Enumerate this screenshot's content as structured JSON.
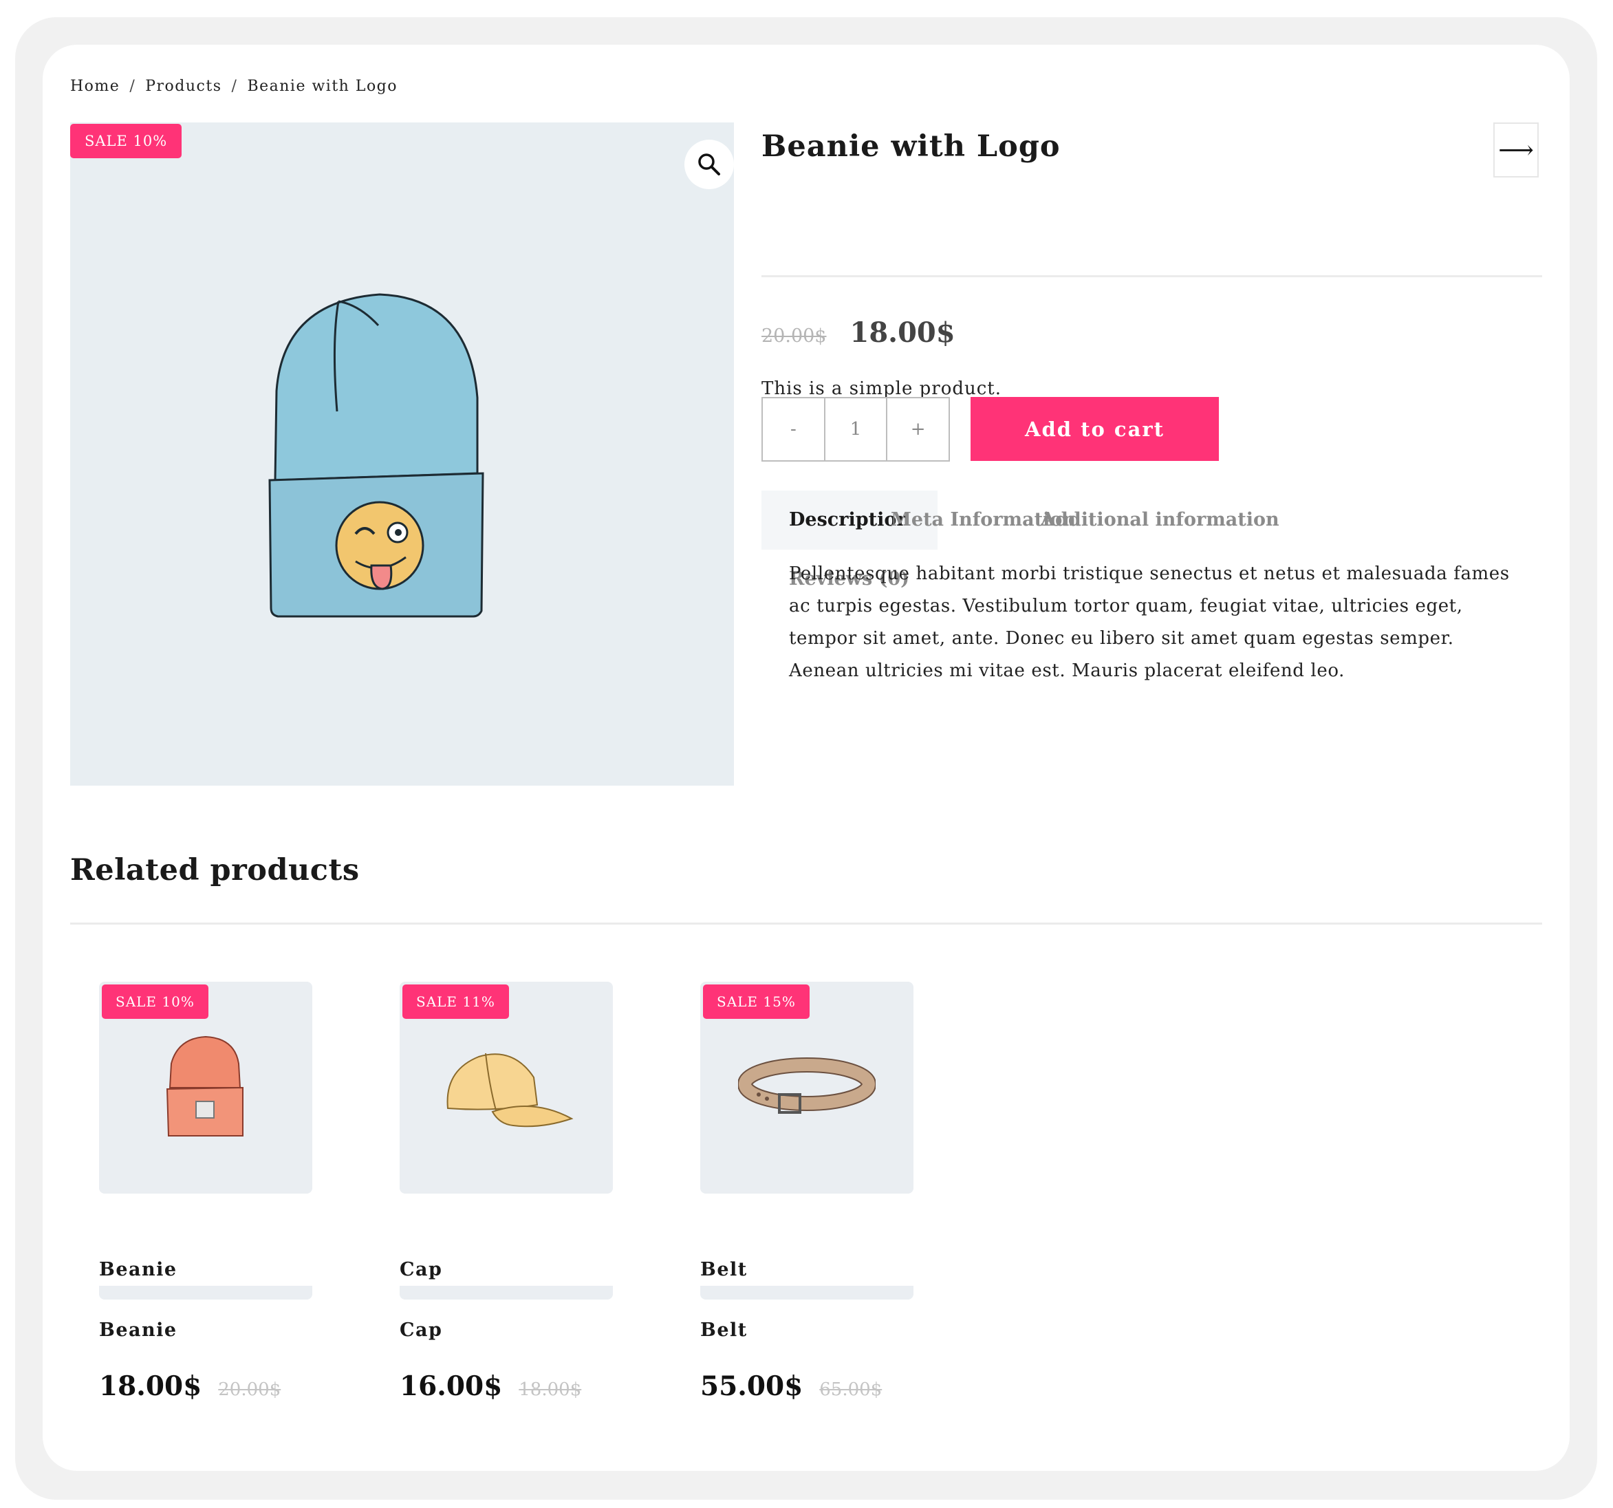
{
  "breadcrumb": {
    "home": "Home",
    "products": "Products",
    "current": "Beanie with Logo",
    "separator": "/"
  },
  "product": {
    "sale_badge": "SALE 10%",
    "title": "Beanie with Logo",
    "old_price": "20.00$",
    "price": "18.00$",
    "short_description": "This is a simple product.",
    "quantity": {
      "minus": "-",
      "value": "1",
      "plus": "+"
    },
    "add_to_cart": "Add to cart",
    "next_icon": "arrow-right-icon",
    "zoom_icon": "search-icon"
  },
  "tabs": [
    {
      "label": "Description",
      "active": true
    },
    {
      "label": "Meta Information",
      "active": false
    },
    {
      "label": "Additional information",
      "active": false
    },
    {
      "label": "Reviews (0)",
      "active": false
    }
  ],
  "description": "Pellentesque habitant morbi tristique senectus et netus et malesuada fames ac turpis egestas. Vestibulum tortor quam, feugiat vitae, ultricies eget, tempor sit amet, ante. Donec eu libero sit amet quam egestas semper. Aenean ultricies mi vitae est. Mauris placerat eleifend leo.",
  "related": {
    "title": "Related products",
    "items": [
      {
        "badge": "SALE 10%",
        "name": "Beanie",
        "name2": "Beanie",
        "price": "18.00$",
        "old_price": "20.00$"
      },
      {
        "badge": "SALE 11%",
        "name": "Cap",
        "name2": "Cap",
        "price": "16.00$",
        "old_price": "18.00$"
      },
      {
        "badge": "SALE 15%",
        "name": "Belt",
        "name2": "Belt",
        "price": "55.00$",
        "old_price": "65.00$"
      }
    ]
  },
  "colors": {
    "accent": "#ff3377",
    "image_bg": "#e8eef2",
    "frame": "#f1f1f1"
  }
}
